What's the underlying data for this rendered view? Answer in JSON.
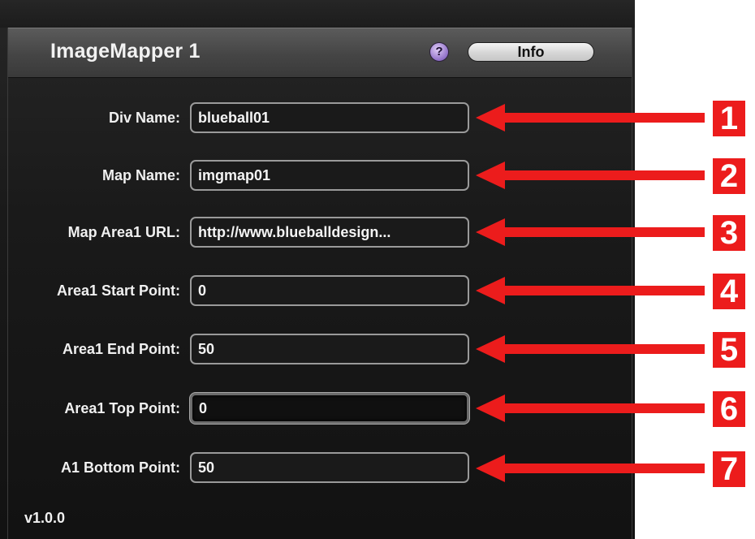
{
  "panel": {
    "title": "ImageMapper 1",
    "help_icon_glyph": "?",
    "info_button_label": "Info",
    "version": "v1.0.0"
  },
  "fields": [
    {
      "label": "Div Name:",
      "value": "blueball01"
    },
    {
      "label": "Map Name:",
      "value": "imgmap01"
    },
    {
      "label": "Map Area1 URL:",
      "value": "http://www.blueballdesign..."
    },
    {
      "label": "Area1 Start Point:",
      "value": "0"
    },
    {
      "label": "Area1 End Point:",
      "value": "50"
    },
    {
      "label": "Area1 Top Point:",
      "value": "0"
    },
    {
      "label": "A1 Bottom Point:",
      "value": "50"
    }
  ],
  "callouts": [
    "1",
    "2",
    "3",
    "4",
    "5",
    "6",
    "7"
  ],
  "colors": {
    "panel_bg": "#1a1a1a",
    "header_bg": "#4a4a4a",
    "callout_red": "#ec1c1c",
    "help_icon": "#9070c8"
  }
}
